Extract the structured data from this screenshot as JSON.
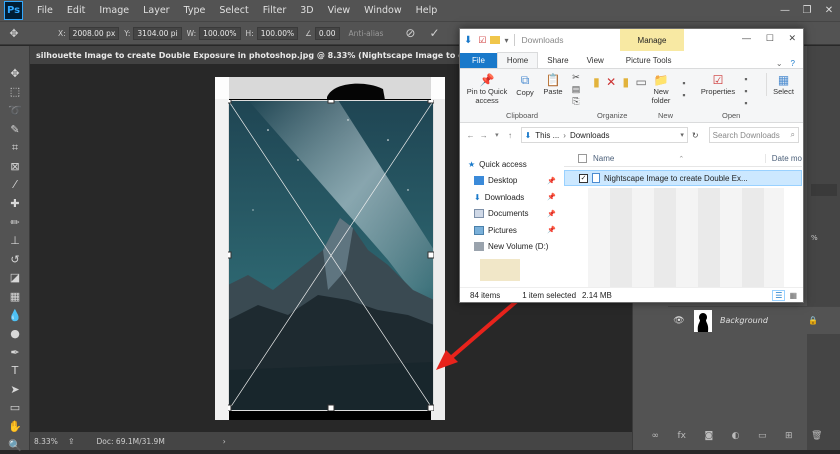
{
  "ps": {
    "logo": "Ps",
    "menus": [
      "File",
      "Edit",
      "Image",
      "Layer",
      "Type",
      "Select",
      "Filter",
      "3D",
      "View",
      "Window",
      "Help"
    ],
    "options": {
      "x_label": "X:",
      "x_value": "2008.00 px",
      "w_label": "W:",
      "w_value": "100.00%",
      "h_label": "H:",
      "h_value": "100.00%",
      "angle_value": "0.00",
      "y_label": "Y:",
      "y_value": "3104.00 pi",
      "antialias": "Anti-alias"
    },
    "doc_tab": "silhouette Image to create Double Exposure in photoshop.jpg @ 8.33% (Nightscape Image to create Double Exposure",
    "status": {
      "zoom": "8.33%",
      "doc": "Doc: 69.1M/31.9M"
    },
    "layers": {
      "background_name": "Background"
    },
    "colors": {
      "ui": "#535353",
      "canvas": "#282828",
      "accent": "#31a8ff",
      "arrow": "#e8231c"
    }
  },
  "explorer": {
    "title": "Downloads",
    "manage_label": "Manage",
    "tabs": [
      "File",
      "Home",
      "Share",
      "View",
      "Picture Tools"
    ],
    "ribbon": {
      "pin": "Pin to Quick access",
      "copy": "Copy",
      "paste": "Paste",
      "new_folder": "New folder",
      "properties": "Properties",
      "select": "Select",
      "groups": [
        "Clipboard",
        "Organize",
        "New",
        "Open"
      ]
    },
    "address": {
      "root": "This ...",
      "current": "Downloads"
    },
    "search_placeholder": "Search Downloads",
    "columns": {
      "name": "Name",
      "date": "Date mo"
    },
    "nav": [
      {
        "label": "Quick access",
        "icon": "star-icon"
      },
      {
        "label": "Desktop",
        "icon": "desktop-icon"
      },
      {
        "label": "Downloads",
        "icon": "download-icon"
      },
      {
        "label": "Documents",
        "icon": "document-icon"
      },
      {
        "label": "Pictures",
        "icon": "picture-icon"
      },
      {
        "label": "New Volume (D:)",
        "icon": "drive-icon"
      }
    ],
    "selected_file": "Nightscape Image to create Double Ex...",
    "status": {
      "items": "84 items",
      "selected": "1 item selected",
      "size": "2.14 MB"
    }
  }
}
